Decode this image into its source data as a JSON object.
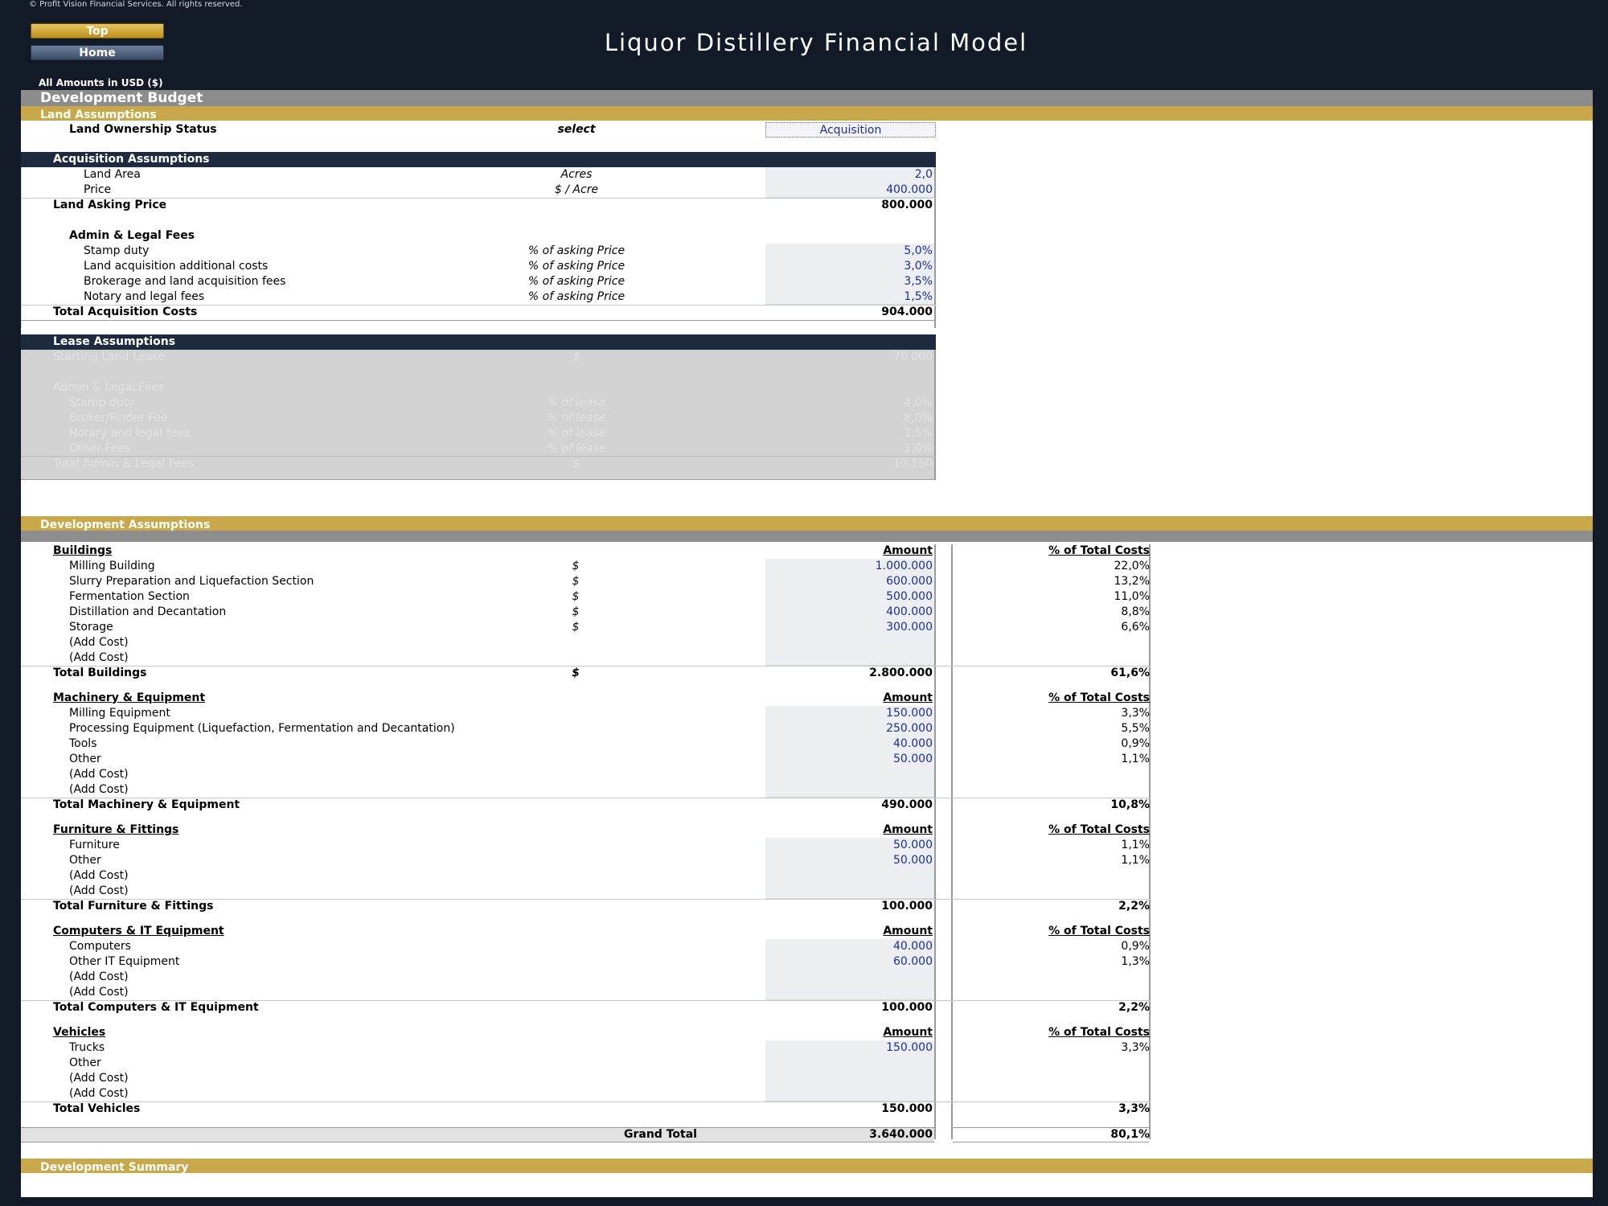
{
  "header": {
    "copyright": "© Profit Vision Financial Services. All rights reserved.",
    "top_button": "Top",
    "home_button": "Home",
    "title": "Liquor Distillery Financial Model",
    "amounts_note": "All Amounts in  USD ($)"
  },
  "sections": {
    "development_budget": "Development Budget",
    "land_assumptions": "Land Assumptions",
    "development_assumptions": "Development Assumptions",
    "development_summary": "Development Summary"
  },
  "land": {
    "ownership_label": "Land Ownership Status",
    "ownership_hint": "select",
    "ownership_value": "Acquisition"
  },
  "acquisition": {
    "header": "Acquisition Assumptions",
    "land_area_label": "Land Area",
    "land_area_unit": "Acres",
    "land_area_value": "2,0",
    "price_label": "Price",
    "price_unit": "$ / Acre",
    "price_value": "400.000",
    "asking_price_label": "Land Asking Price",
    "asking_price_value": "800.000",
    "fees_header": "Admin & Legal Fees",
    "fees": [
      {
        "label": "Stamp duty",
        "unit": "% of asking Price",
        "value": "5,0%"
      },
      {
        "label": "Land acquisition additional costs",
        "unit": "% of asking Price",
        "value": "3,0%"
      },
      {
        "label": "Brokerage and land acquisition fees",
        "unit": "% of asking Price",
        "value": "3,5%"
      },
      {
        "label": "Notary and legal fees",
        "unit": "% of asking Price",
        "value": "1,5%"
      }
    ],
    "total_label": "Total Acquisition Costs",
    "total_value": "904.000"
  },
  "lease": {
    "header": "Lease Assumptions",
    "starting_label": "Starting Land Lease",
    "starting_unit": "$",
    "starting_value": "70.000",
    "fees_header": "Admin & Legal Fees",
    "fees": [
      {
        "label": "Stamp duty",
        "unit": "% of lease",
        "value": "4,0%"
      },
      {
        "label": "Broker/Finder Fee",
        "unit": "% of lease",
        "value": "8,0%"
      },
      {
        "label": "Notary and legal fees",
        "unit": "% of lease",
        "value": "1,5%"
      },
      {
        "label": "Other Fees",
        "unit": "% of lease",
        "value": "1,0%"
      }
    ],
    "total_label": "Total Admin & Legal Fees",
    "total_unit": "$",
    "total_value": "10.150"
  },
  "development": {
    "amount_header": "Amount",
    "pct_header": "% of Total Costs",
    "buildings": {
      "header": "Buildings",
      "items": [
        {
          "label": "Milling Building",
          "unit": "$",
          "amount": "1.000.000",
          "pct": "22,0%"
        },
        {
          "label": "Slurry Preparation and Liquefaction Section",
          "unit": "$",
          "amount": "600.000",
          "pct": "13,2%"
        },
        {
          "label": "Fermentation Section",
          "unit": "$",
          "amount": "500.000",
          "pct": "11,0%"
        },
        {
          "label": "Distillation and Decantation",
          "unit": "$",
          "amount": "400.000",
          "pct": "8,8%"
        },
        {
          "label": "Storage",
          "unit": "$",
          "amount": "300.000",
          "pct": "6,6%"
        },
        {
          "label": "(Add Cost)",
          "unit": "",
          "amount": "",
          "pct": ""
        },
        {
          "label": "(Add Cost)",
          "unit": "",
          "amount": "",
          "pct": ""
        }
      ],
      "total_label": "Total Buildings",
      "total_unit": "$",
      "total_amount": "2.800.000",
      "total_pct": "61,6%"
    },
    "machinery": {
      "header": "Machinery & Equipment",
      "items": [
        {
          "label": "Milling Equipment",
          "amount": "150.000",
          "pct": "3,3%"
        },
        {
          "label": "Processing Equipment (Liquefaction, Fermentation and Decantation)",
          "amount": "250.000",
          "pct": "5,5%"
        },
        {
          "label": "Tools",
          "amount": "40.000",
          "pct": "0,9%"
        },
        {
          "label": "Other",
          "amount": "50.000",
          "pct": "1,1%"
        },
        {
          "label": "(Add Cost)",
          "amount": "",
          "pct": ""
        },
        {
          "label": "(Add Cost)",
          "amount": "",
          "pct": ""
        }
      ],
      "total_label": "Total Machinery & Equipment",
      "total_amount": "490.000",
      "total_pct": "10,8%"
    },
    "furniture": {
      "header": "Furniture & Fittings",
      "items": [
        {
          "label": "Furniture",
          "amount": "50.000",
          "pct": "1,1%"
        },
        {
          "label": "Other",
          "amount": "50.000",
          "pct": "1,1%"
        },
        {
          "label": "(Add Cost)",
          "amount": "",
          "pct": ""
        },
        {
          "label": "(Add Cost)",
          "amount": "",
          "pct": ""
        }
      ],
      "total_label": "Total Furniture & Fittings",
      "total_amount": "100.000",
      "total_pct": "2,2%"
    },
    "computers": {
      "header": "Computers & IT Equipment",
      "items": [
        {
          "label": "Computers",
          "amount": "40.000",
          "pct": "0,9%"
        },
        {
          "label": "Other IT Equipment",
          "amount": "60.000",
          "pct": "1,3%"
        },
        {
          "label": "(Add Cost)",
          "amount": "",
          "pct": ""
        },
        {
          "label": "(Add Cost)",
          "amount": "",
          "pct": ""
        }
      ],
      "total_label": "Total Computers & IT Equipment",
      "total_amount": "100.000",
      "total_pct": "2,2%"
    },
    "vehicles": {
      "header": "Vehicles",
      "items": [
        {
          "label": "Trucks",
          "amount": "150.000",
          "pct": "3,3%"
        },
        {
          "label": "Other",
          "amount": "",
          "pct": ""
        },
        {
          "label": "(Add Cost)",
          "amount": "",
          "pct": ""
        },
        {
          "label": "(Add Cost)",
          "amount": "",
          "pct": ""
        }
      ],
      "total_label": "Total Vehicles",
      "total_amount": "150.000",
      "total_pct": "3,3%"
    },
    "grand_total_label": "Grand Total",
    "grand_total_amount": "3.640.000",
    "grand_total_pct": "80,1%"
  }
}
